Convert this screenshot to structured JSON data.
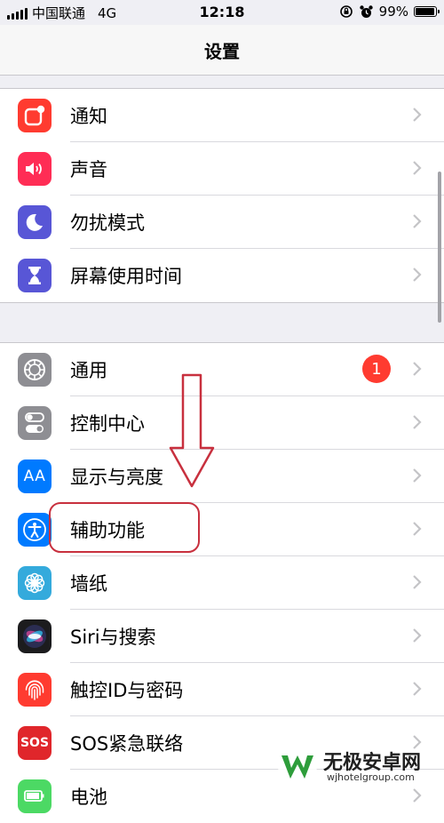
{
  "status_bar": {
    "carrier": "中国联通",
    "network": "4G",
    "time": "12:18",
    "battery": "99%"
  },
  "nav": {
    "title": "设置"
  },
  "groups": [
    {
      "items": [
        {
          "label": "通知",
          "icon": "notifications-icon",
          "color": "#ff3b30"
        },
        {
          "label": "声音",
          "icon": "sounds-icon",
          "color": "#ff2d55"
        },
        {
          "label": "勿扰模式",
          "icon": "moon-icon",
          "color": "#5856d6"
        },
        {
          "label": "屏幕使用时间",
          "icon": "hourglass-icon",
          "color": "#5856d6"
        }
      ]
    },
    {
      "items": [
        {
          "label": "通用",
          "icon": "gear-icon",
          "color": "#8e8e93",
          "badge": "1"
        },
        {
          "label": "控制中心",
          "icon": "toggles-icon",
          "color": "#8e8e93"
        },
        {
          "label": "显示与亮度",
          "icon": "aa-icon",
          "color": "#007aff",
          "icon_text": "AA"
        },
        {
          "label": "辅助功能",
          "icon": "accessibility-icon",
          "color": "#007aff"
        },
        {
          "label": "墙纸",
          "icon": "flower-icon",
          "color": "#34aadc"
        },
        {
          "label": "Siri与搜索",
          "icon": "siri-icon",
          "color": "#1c1c1e"
        },
        {
          "label": "触控ID与密码",
          "icon": "fingerprint-icon",
          "color": "#ff3b30"
        },
        {
          "label": "SOS紧急联络",
          "icon": "sos-icon",
          "color": "#e0262b",
          "icon_text": "SOS"
        },
        {
          "label": "电池",
          "icon": "battery-icon",
          "color": "#4cd964"
        }
      ]
    }
  ],
  "badge_color": "#ff3b30",
  "annotation": {
    "color": "#c8303e"
  },
  "watermark": {
    "name": "无极安卓网",
    "url": "wjhotelgroup.com"
  }
}
